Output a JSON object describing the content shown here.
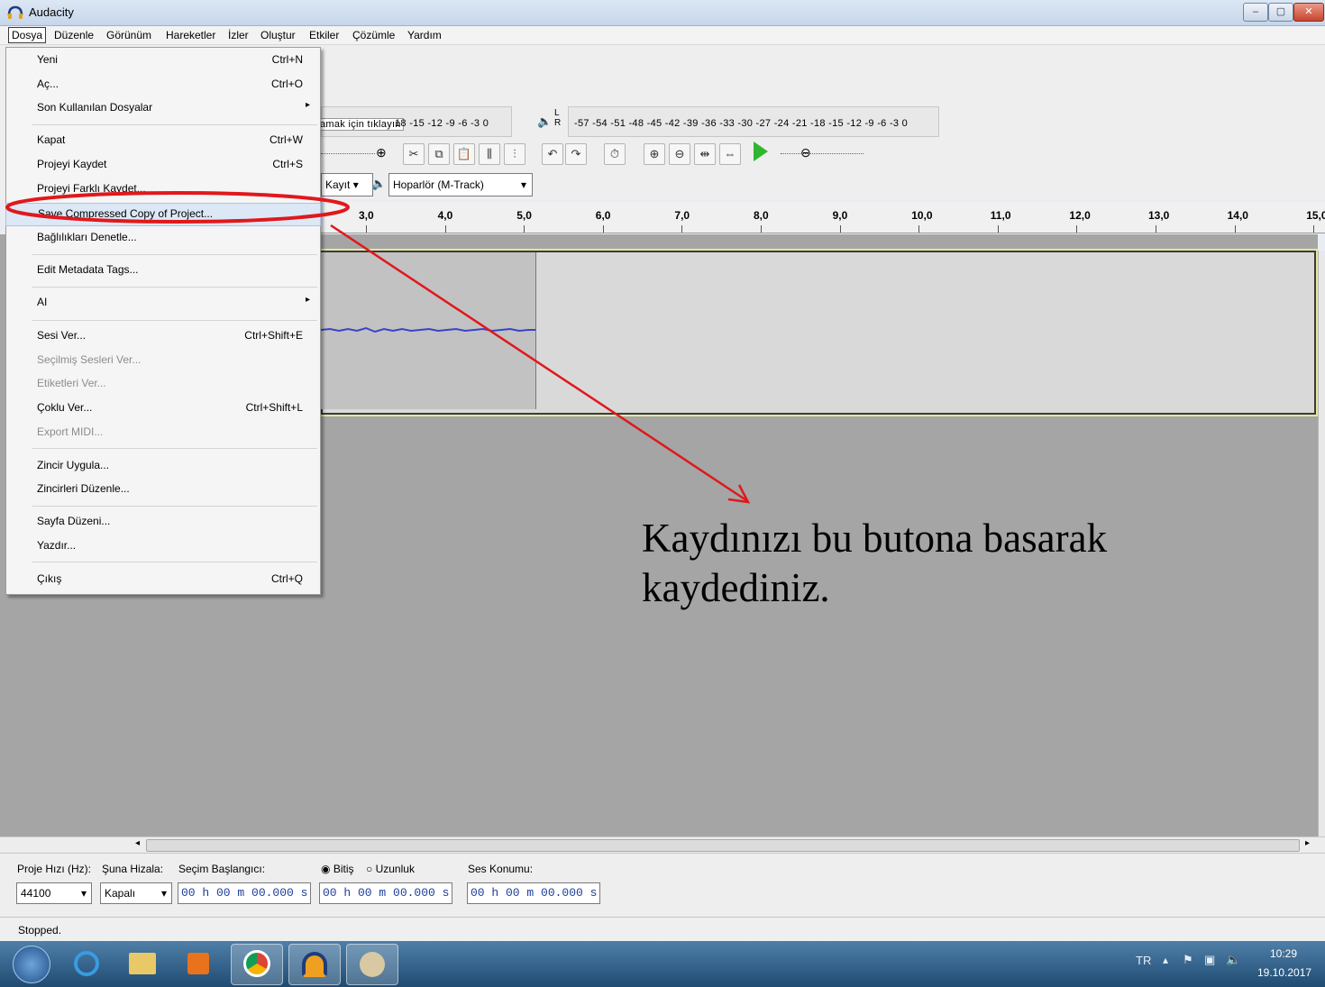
{
  "window": {
    "title": "Audacity",
    "minimize": "–",
    "maximize": "▢",
    "close": "✕"
  },
  "menubar": [
    "Dosya",
    "Düzenle",
    "Görünüm",
    "Hareketler",
    "İzler",
    "Oluştur",
    "Etkiler",
    "Çözümle",
    "Yardım"
  ],
  "dropdown": {
    "items": [
      {
        "label": "Yeni",
        "shortcut": "Ctrl+N"
      },
      {
        "label": "Aç...",
        "shortcut": "Ctrl+O"
      },
      {
        "label": "Son Kullanılan Dosyalar",
        "shortcut": "▸"
      },
      {
        "label": "Kapat",
        "shortcut": "Ctrl+W"
      },
      {
        "label": "Projeyi Kaydet",
        "shortcut": "Ctrl+S"
      },
      {
        "label": "Projeyi Farklı Kaydet...",
        "shortcut": ""
      },
      {
        "label": "Save Compressed Copy of Project...",
        "shortcut": ""
      },
      {
        "label": "Bağlılıkları Denetle...",
        "shortcut": ""
      },
      {
        "label": "Edit Metadata Tags...",
        "shortcut": ""
      },
      {
        "label": "AI",
        "shortcut": "▸"
      },
      {
        "label": "Sesi Ver...",
        "shortcut": "Ctrl+Shift+E"
      },
      {
        "label": "Seçilmiş Sesleri Ver...",
        "shortcut": ""
      },
      {
        "label": "Etiketleri Ver...",
        "shortcut": ""
      },
      {
        "label": "Çoklu Ver...",
        "shortcut": "Ctrl+Shift+L"
      },
      {
        "label": "Export MIDI...",
        "shortcut": ""
      },
      {
        "label": "Zincir Uygula...",
        "shortcut": ""
      },
      {
        "label": "Zincirleri Düzenle...",
        "shortcut": ""
      },
      {
        "label": "Sayfa Düzeni...",
        "shortcut": ""
      },
      {
        "label": "Yazdır...",
        "shortcut": ""
      },
      {
        "label": "Çıkış",
        "shortcut": "Ctrl+Q"
      }
    ]
  },
  "meters": {
    "record_hint": "amak için tıklayın",
    "record_scale": "18 -15 -12 -9 -6 -3 0",
    "play_lr": "L R",
    "play_scale": "-57 -54 -51 -48 -45 -42 -39 -36 -33 -30 -27 -24 -21 -18 -15 -12 -9 -6 -3 0"
  },
  "devices": {
    "record": "Kayıt",
    "output": "Hoparlör (M-Track)"
  },
  "ruler": [
    "3,0",
    "4,0",
    "5,0",
    "6,0",
    "7,0",
    "8,0",
    "9,0",
    "10,0",
    "11,0",
    "12,0",
    "13,0",
    "14,0",
    "15,0"
  ],
  "annotation": {
    "line1": "Kaydınızı bu butona basarak",
    "line2": "kaydediniz."
  },
  "selection": {
    "rate_label": "Proje Hızı (Hz):",
    "snap_label": "Şuna Hizala:",
    "start_label": "Seçim Başlangıcı:",
    "end_label": "Bitiş",
    "length_label": "Uzunluk",
    "pos_label": "Ses Konumu:",
    "rate_value": "44100",
    "snap_value": "Kapalı",
    "start_time": "00 h 00 m 00.000 s",
    "end_time": "00 h 00 m 00.000 s",
    "pos_time": "00 h 00 m 00.000 s"
  },
  "status": "Stopped.",
  "taskbar": {
    "lang": "TR",
    "time": "10:29",
    "date": "19.10.2017"
  },
  "colors": {
    "highlight_oval": "#e0181c",
    "arrow": "#e0181c",
    "waveform": "#3a43c9"
  }
}
